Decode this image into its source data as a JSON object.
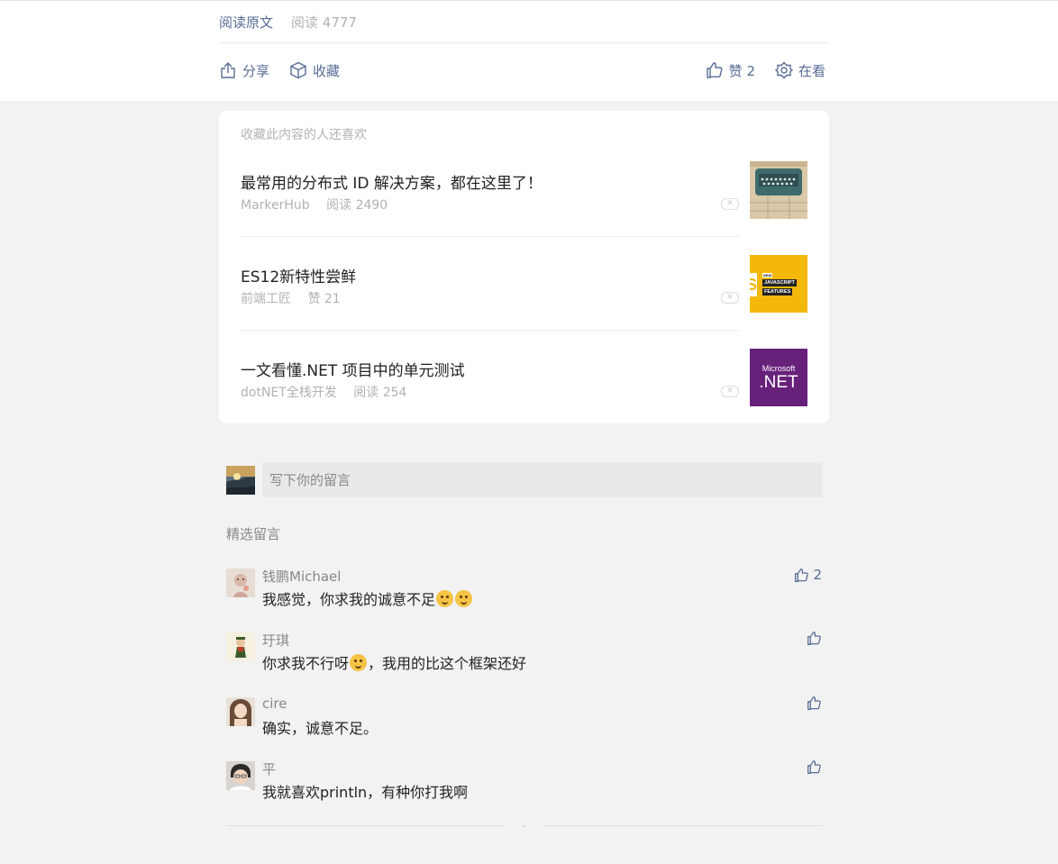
{
  "meta": {
    "read_original": "阅读原文",
    "reads": "阅读 4777"
  },
  "actions": {
    "share": "分享",
    "collect": "收藏",
    "like": "赞 2",
    "watching": "在看"
  },
  "recommend": {
    "title": "收藏此内容的人还喜欢",
    "items": [
      {
        "title": "最常用的分布式 ID 解决方案，都在这里了！",
        "source": "MarkerHub",
        "stat": "阅读 2490"
      },
      {
        "title": "ES12新特性尝鲜",
        "source": "前端工匠",
        "stat": "赞 21"
      },
      {
        "title": "一文看懂.NET 项目中的单元测试",
        "source": "dotNET全栈开发",
        "stat": "阅读 254"
      }
    ],
    "thumb2_text1": "NEW",
    "thumb2_text2": "JAVASCRIPT",
    "thumb2_text3": "FEATURES",
    "thumb3_text1": "Microsoft",
    "thumb3_text2": ".NET"
  },
  "comment_input": {
    "placeholder": "写下你的留言"
  },
  "featured_label": "精选留言",
  "comments": [
    {
      "name": "钱鹏Michael",
      "text": "我感觉，你求我的诚意不足",
      "likes": "2"
    },
    {
      "name": "玗琪",
      "text_a": "你求我不行呀",
      "text_b": "，我用的比这个框架还好",
      "likes": ""
    },
    {
      "name": "cire",
      "text": "确实，诚意不足。",
      "likes": ""
    },
    {
      "name": "平",
      "text": "我就喜欢println，有种你打我啊",
      "likes": ""
    }
  ],
  "colors": {
    "link": "#576b95",
    "muted": "#b2b2b2",
    "bg": "#f2f2f2"
  }
}
